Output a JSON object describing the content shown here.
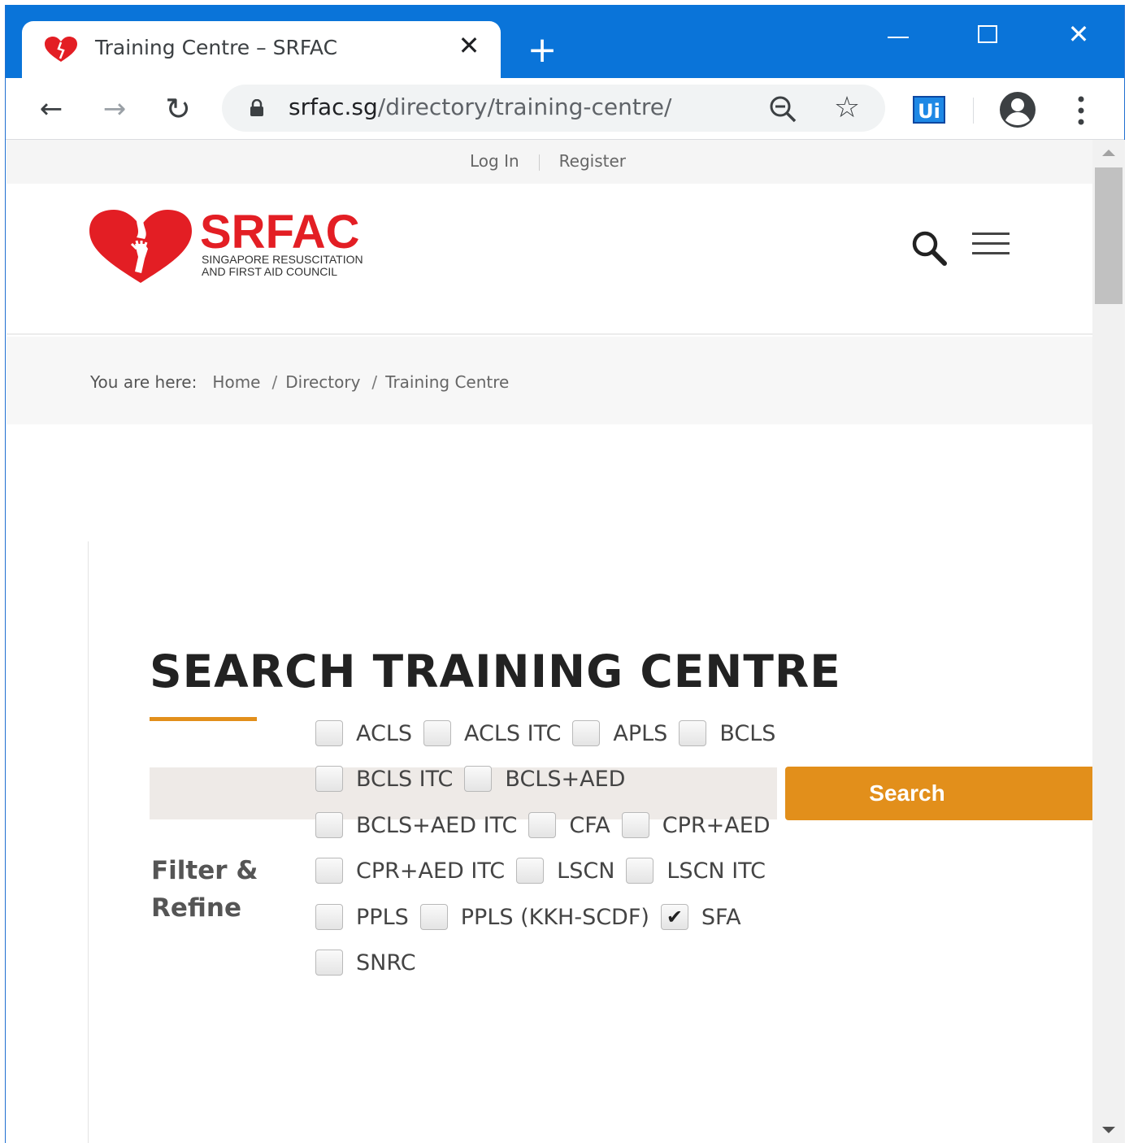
{
  "browser": {
    "tab_title": "Training Centre – SRFAC",
    "new_tab_label": "+",
    "url_host": "srfac.sg",
    "url_path": "/directory/training-centre/",
    "extension_label": "Ui",
    "icons": [
      "heart-favicon-icon",
      "close-icon",
      "plus-icon",
      "minimize-icon",
      "maximize-icon",
      "window-close-icon",
      "back-arrow-icon",
      "forward-arrow-icon",
      "reload-icon",
      "lock-icon",
      "zoom-out-icon",
      "star-icon",
      "profile-icon",
      "more-vert-icon"
    ]
  },
  "topbar": {
    "login": "Log In",
    "register": "Register"
  },
  "logo": {
    "word": "SRFAC",
    "sub_line1": "SINGAPORE RESUSCITATION",
    "sub_line2": "AND FIRST AID COUNCIL",
    "color": "#e31e24"
  },
  "breadcrumb": {
    "prefix": "You are here:",
    "items": [
      "Home",
      "Directory",
      "Training Centre"
    ]
  },
  "main": {
    "title": "SEARCH TRAINING CENTRE",
    "accent_color": "#e28f1b",
    "search_input_value": "",
    "search_button": "Search",
    "filter_label_line1": "Filter &",
    "filter_label_line2": "Refine",
    "filters": [
      [
        {
          "label": "ACLS",
          "checked": false
        },
        {
          "label": "ACLS ITC",
          "checked": false
        },
        {
          "label": "APLS",
          "checked": false
        },
        {
          "label": "BCLS",
          "checked": false
        }
      ],
      [
        {
          "label": "BCLS ITC",
          "checked": false
        },
        {
          "label": "BCLS+AED",
          "checked": false
        }
      ],
      [
        {
          "label": "BCLS+AED ITC",
          "checked": false
        },
        {
          "label": "CFA",
          "checked": false
        },
        {
          "label": "CPR+AED",
          "checked": false
        }
      ],
      [
        {
          "label": "CPR+AED ITC",
          "checked": false
        },
        {
          "label": "LSCN",
          "checked": false
        },
        {
          "label": "LSCN ITC",
          "checked": false
        }
      ],
      [
        {
          "label": "PPLS",
          "checked": false
        },
        {
          "label": "PPLS (KKH-SCDF)",
          "checked": false
        },
        {
          "label": "SFA",
          "checked": true
        }
      ],
      [
        {
          "label": "SNRC",
          "checked": false
        }
      ]
    ]
  }
}
